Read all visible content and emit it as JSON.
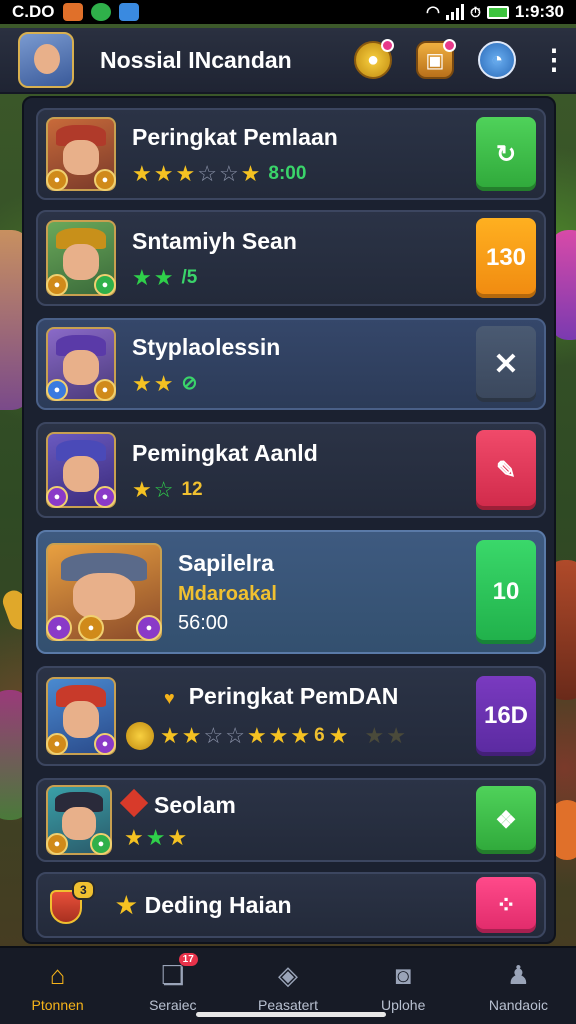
{
  "status_bar": {
    "time_left": "C.DO",
    "time_right": "1:9:30"
  },
  "header": {
    "title": "Nossial INcandan",
    "icons": [
      "coin-icon",
      "treasure-chest-icon",
      "clock-icon",
      "more-vertical-icon"
    ]
  },
  "cards": [
    {
      "title": "Peringkat Pemlaan",
      "rating_stars": [
        "filled",
        "filled",
        "filled",
        "empty",
        "empty",
        "filled"
      ],
      "meta": "8:00",
      "action_label": "↻",
      "action_icon": "refresh-icon",
      "action_color": "green"
    },
    {
      "title": "Sntamiyh Sean",
      "rating_stars": [
        "green",
        "green"
      ],
      "meta": "/5",
      "action_label": "130",
      "action_color": "orange"
    },
    {
      "title": "Styplaolessin",
      "rating_stars": [
        "filled",
        "filled"
      ],
      "meta": "⊘",
      "action_label": "✕",
      "action_icon": "close-icon",
      "action_color": "slate"
    },
    {
      "title": "Pemingkat Aanld",
      "rating_stars": [
        "filled",
        "outline-green"
      ],
      "meta": "12",
      "action_label": "✎",
      "action_icon": "edit-icon",
      "action_color": "red"
    },
    {
      "title": "Sapilelra",
      "subtitle": "Mdaroakal",
      "time": "56:00",
      "action_label": "10",
      "action_color": "green"
    },
    {
      "title": "Peringkat PemDAN",
      "title_prefix": "♥",
      "rating_stars": [
        "filled",
        "filled",
        "empty",
        "empty",
        "filled",
        "filled",
        "filled"
      ],
      "meta": "6",
      "trailing_stars": [
        "filled",
        "dim",
        "dim"
      ],
      "action_label": "16D",
      "action_color": "purple"
    },
    {
      "title": "Seolam",
      "rating_stars": [
        "filled",
        "green",
        "filled"
      ],
      "action_label": "❖",
      "action_icon": "layers-icon",
      "action_color": "green"
    },
    {
      "title": "Deding Haian",
      "badge_text": "3",
      "action_label": "⁘",
      "action_icon": "dots-icon",
      "action_color": "pink"
    }
  ],
  "bottom_nav": [
    {
      "label": "Ptonnen",
      "icon": "home-icon",
      "active": true
    },
    {
      "label": "Seraiec",
      "icon": "cards-icon",
      "badge": "17"
    },
    {
      "label": "Peasatert",
      "icon": "shield-icon"
    },
    {
      "label": "Uplohe",
      "icon": "upload-icon"
    },
    {
      "label": "Nandaoic",
      "icon": "profile-icon"
    }
  ]
}
